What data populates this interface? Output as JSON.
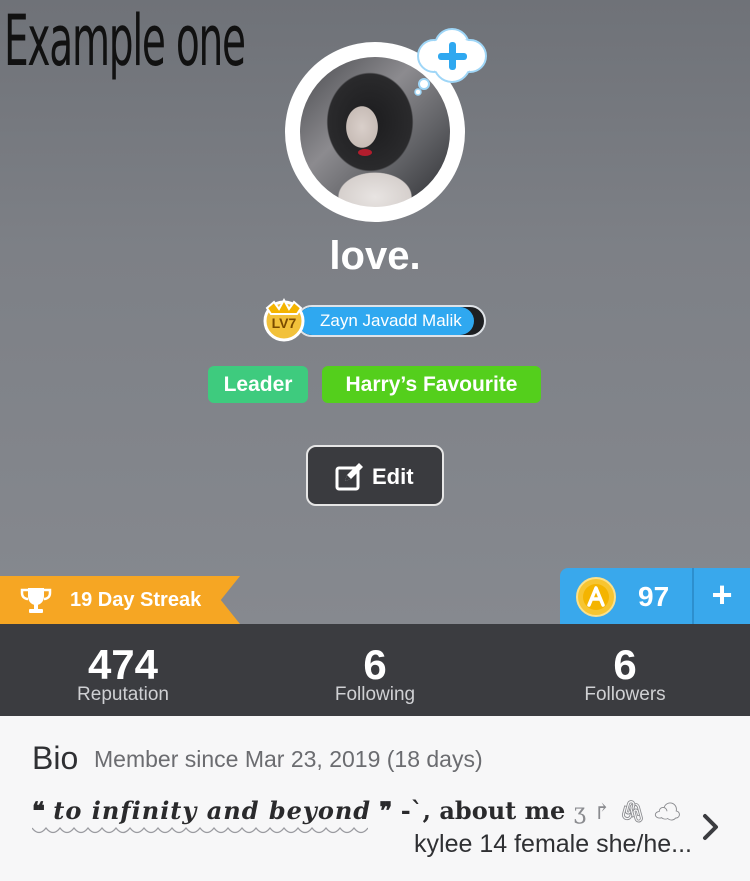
{
  "overlay_title": "Example one",
  "profile": {
    "username": "love.",
    "level_badge": "LV7",
    "title": "Zayn Javadd Malik",
    "tags": [
      "Leader",
      "Harry’s Favourite"
    ],
    "edit_label": "Edit"
  },
  "streak": {
    "label": "19 Day Streak"
  },
  "coins": {
    "value": "97",
    "add": "+"
  },
  "stats": [
    {
      "value": "474",
      "label": "Reputation"
    },
    {
      "value": "6",
      "label": "Following"
    },
    {
      "value": "6",
      "label": "Followers"
    }
  ],
  "bio": {
    "heading": "Bio",
    "member_since": "Member since Mar 23, 2019 (18 days)",
    "quote_open": "❝",
    "quote_text": "to infinity and beyond",
    "quote_close": "❞",
    "quote_tail": "-`, about me",
    "quote_symbols": "ʒ ↱ 🖇 ☁",
    "preview": "kylee 14 female she/he..."
  },
  "colors": {
    "streak": "#f6a623",
    "coins": "#39a8ec",
    "tag_leader": "#3ecb7e",
    "tag_favourite": "#54cf1c",
    "title_pill": "#2fa8f0",
    "stats_bar": "#3b3c40"
  },
  "icons": {
    "add_bubble": "plus-cloud-icon",
    "edit": "edit-pencil-icon",
    "streak": "trophy-icon",
    "coin": "coin-icon",
    "more": "chevron-right-icon"
  }
}
